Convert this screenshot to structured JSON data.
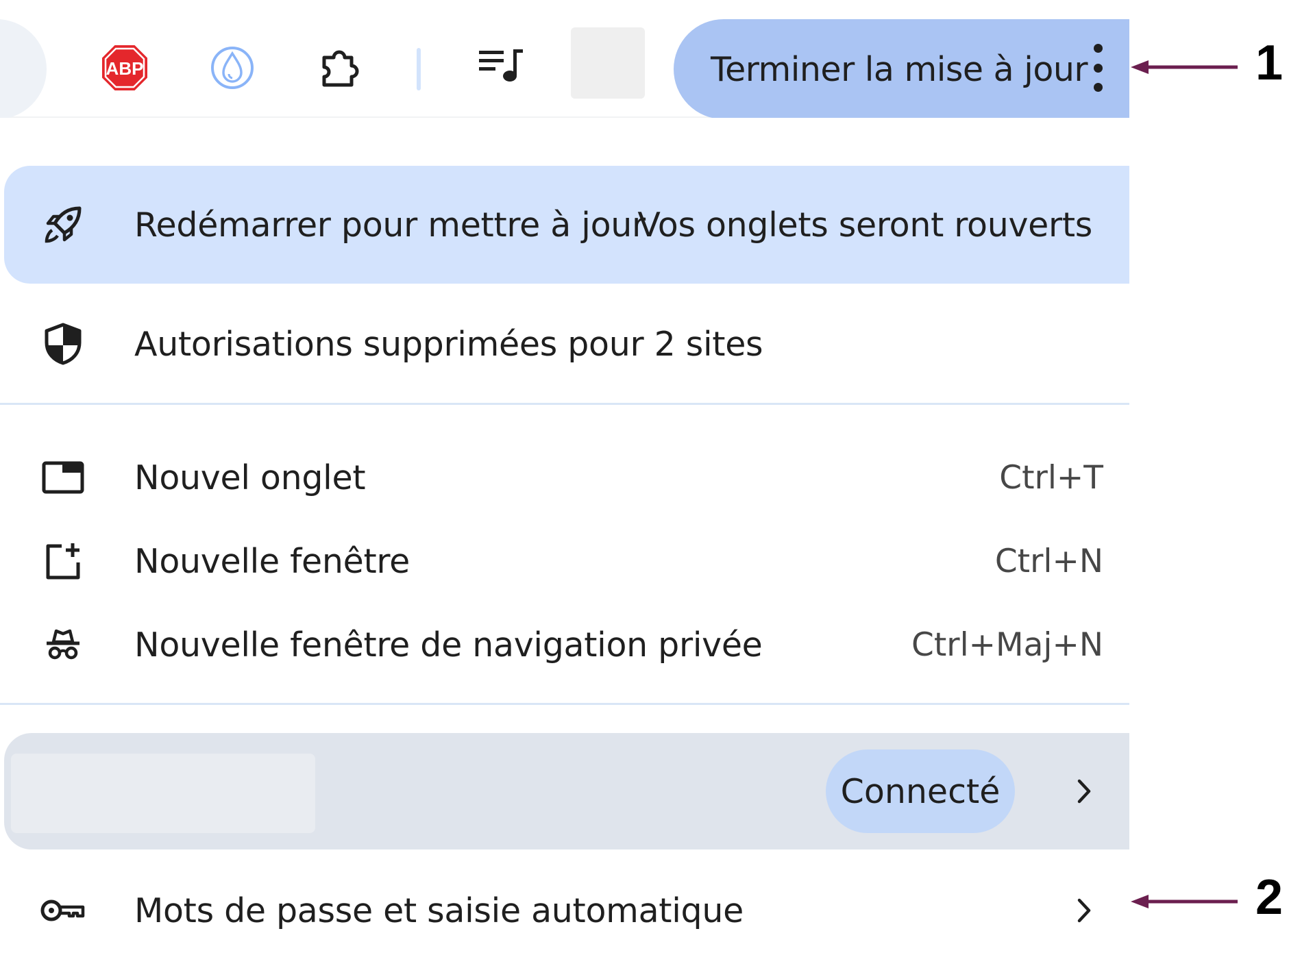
{
  "toolbar": {
    "icons": [
      "abp-icon",
      "drop-icon",
      "puzzle-icon",
      "media-control-icon"
    ],
    "abp_text": "ABP",
    "update_button_label": "Terminer la mise à jour",
    "menu_icon": "kebab-icon"
  },
  "annotations": [
    {
      "label": "1"
    },
    {
      "label": "2"
    }
  ],
  "menu": {
    "update_item": {
      "icon": "rocket-icon",
      "label": "Redémarrer pour mettre à jour",
      "hint": "Vos onglets seront rouverts"
    },
    "permissions_item": {
      "icon": "shield-icon",
      "label": "Autorisations supprimées pour 2 sites"
    },
    "items": [
      {
        "icon": "new-tab-icon",
        "label": "Nouvel onglet",
        "shortcut": "Ctrl+T"
      },
      {
        "icon": "new-window-icon",
        "label": "Nouvelle fenêtre",
        "shortcut": "Ctrl+N"
      },
      {
        "icon": "incognito-icon",
        "label": "Nouvelle fenêtre de navigation privée",
        "shortcut": "Ctrl+Maj+N"
      }
    ],
    "account": {
      "status": "Connecté"
    },
    "passwords_item": {
      "icon": "key-icon",
      "label": "Mots de passe et saisie automatique"
    }
  },
  "colors": {
    "update_button": "#aac4f3",
    "update_row": "#d3e3fd",
    "account_row": "#dfe4ec",
    "connected_chip": "#c2d7f8",
    "annotation_arrow": "#6b1f4f",
    "abp_red": "#e4272c"
  }
}
